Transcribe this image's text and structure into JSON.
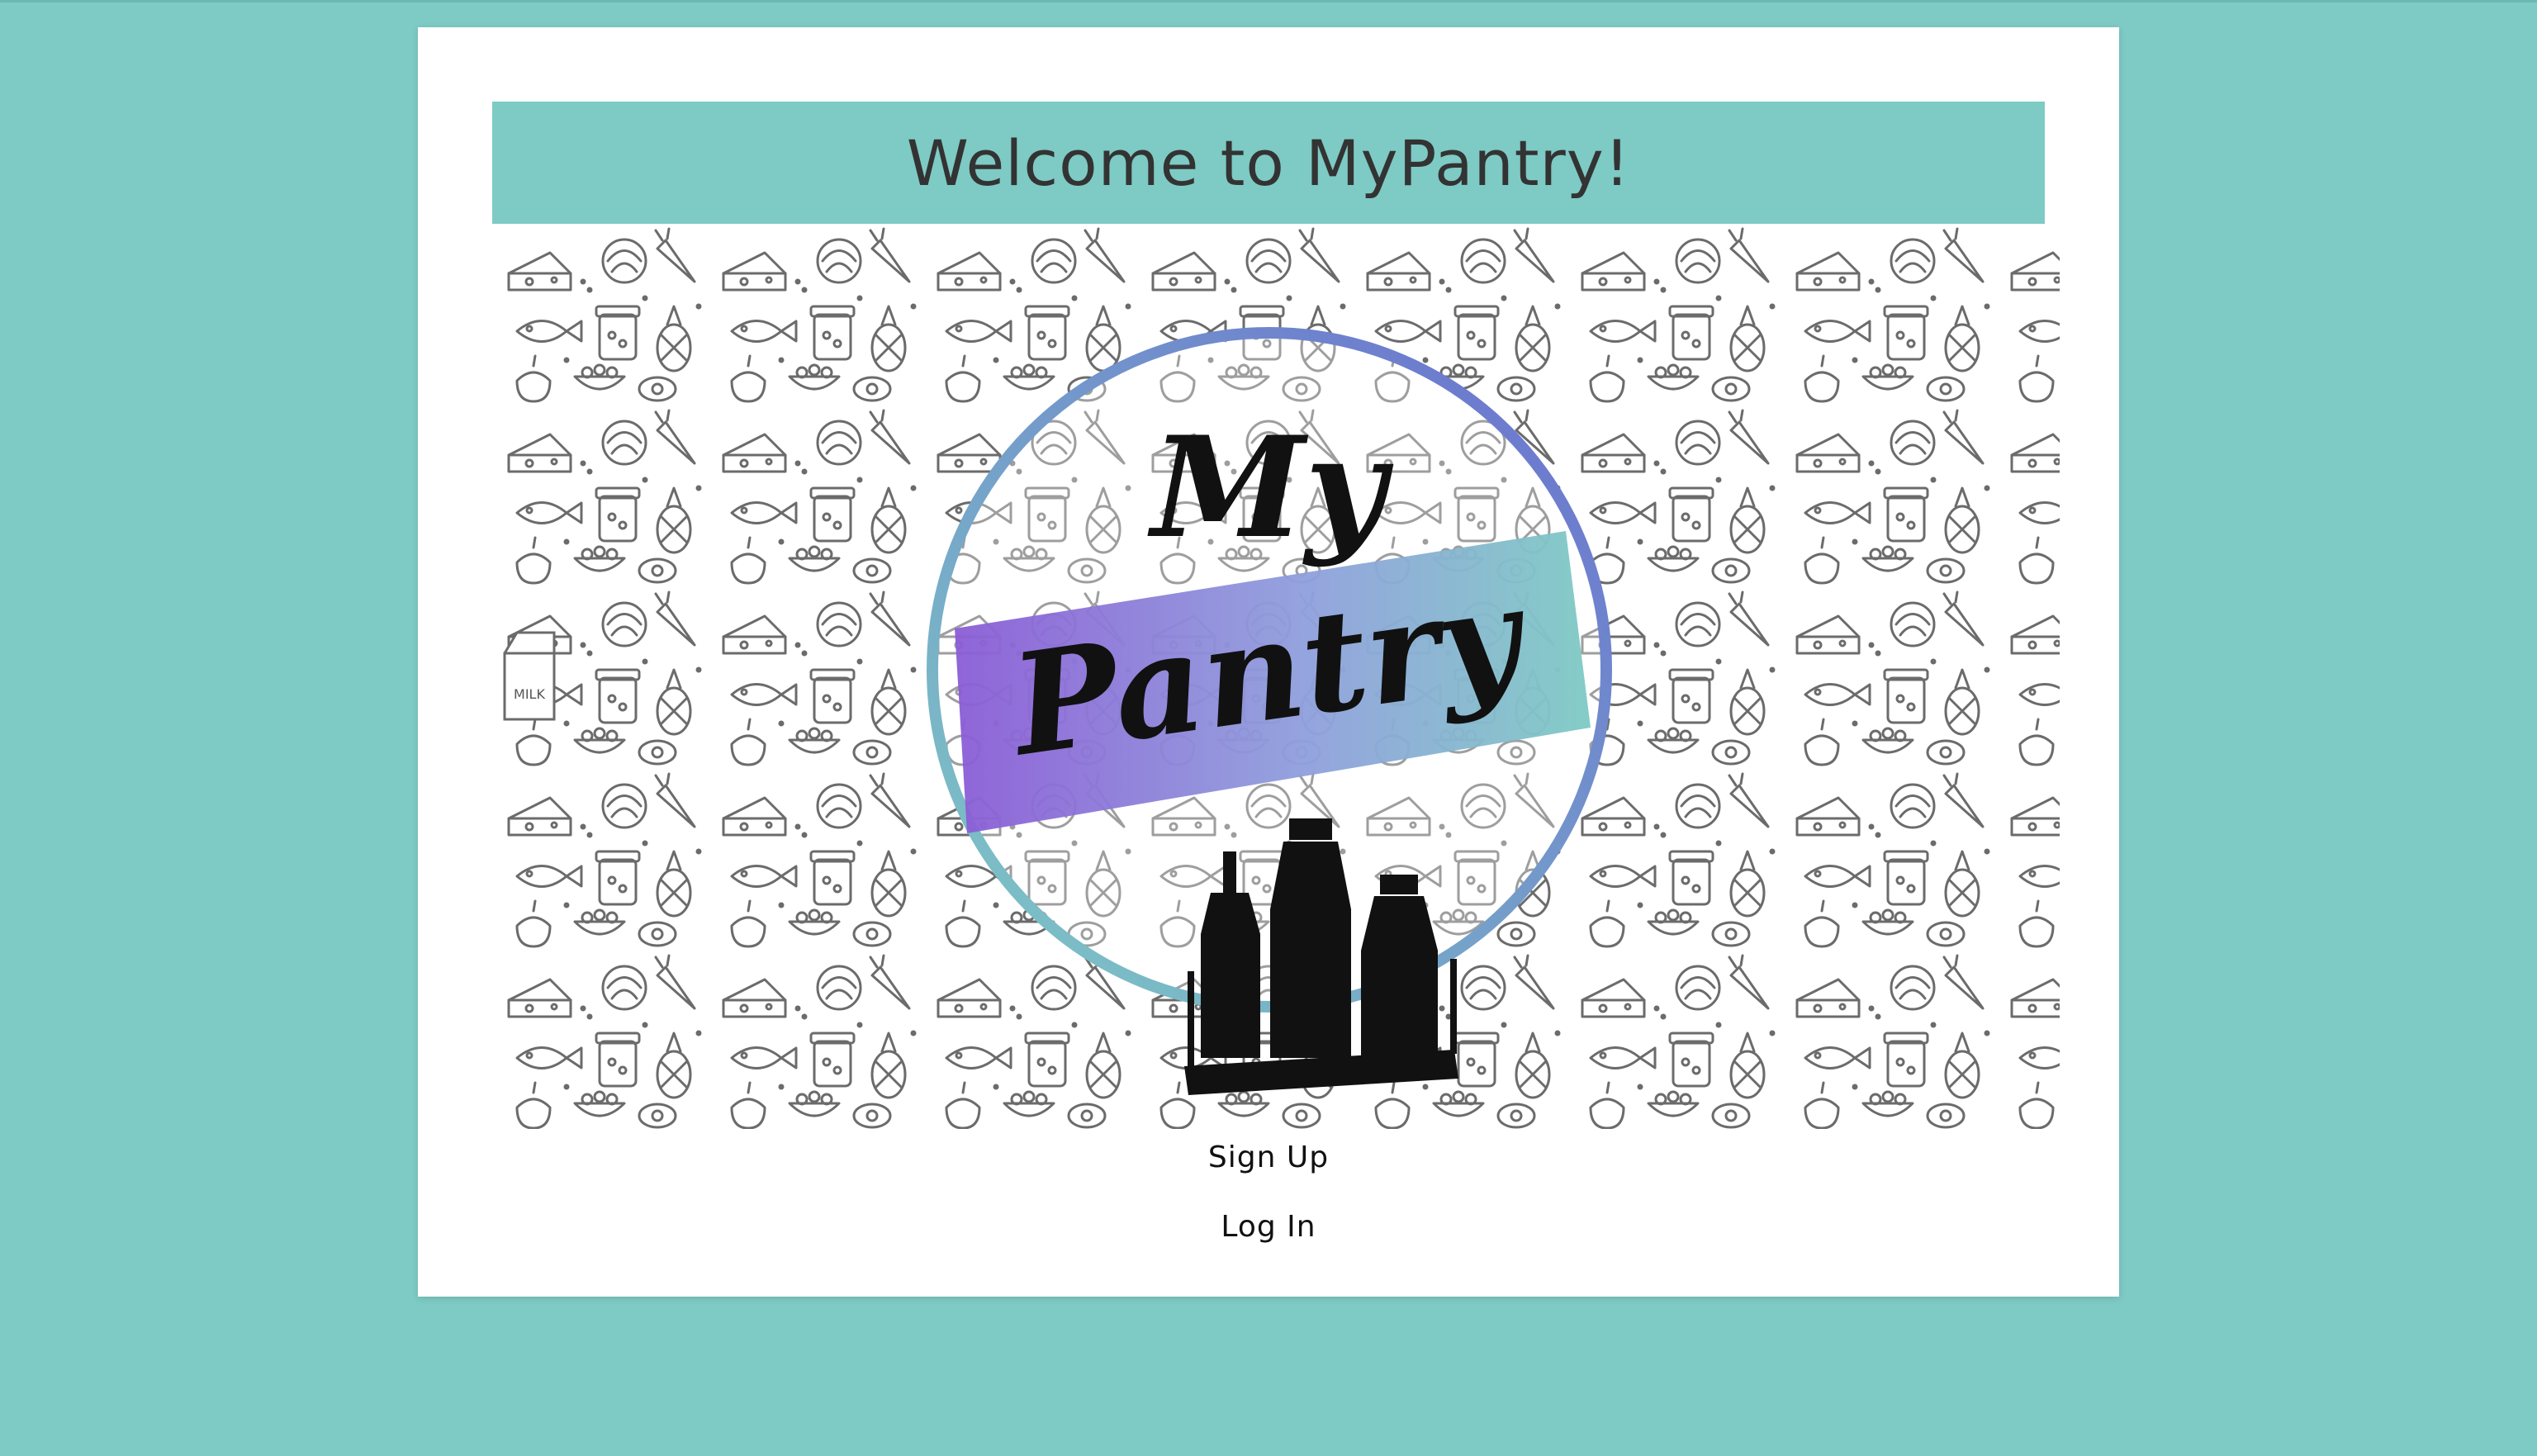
{
  "header": {
    "title": "Welcome to MyPantry!"
  },
  "hero": {
    "logo_top_word": "My",
    "logo_bottom_word": "Pantry",
    "milk_label": "MILK"
  },
  "actions": {
    "signup_label": "Sign Up",
    "login_label": "Log In"
  },
  "colors": {
    "page_background": "#7ecac4",
    "card_background": "#ffffff",
    "banner_background": "#7ecac4",
    "title_text": "#333333",
    "ring_gradient_start": "#7ecac4",
    "ring_gradient_end": "#6a6fd0",
    "ribbon_gradient_start": "#8a5cd6",
    "ribbon_gradient_end": "#7ecac4"
  },
  "icons": [
    "food-doodle-pattern",
    "bottles-icon"
  ]
}
